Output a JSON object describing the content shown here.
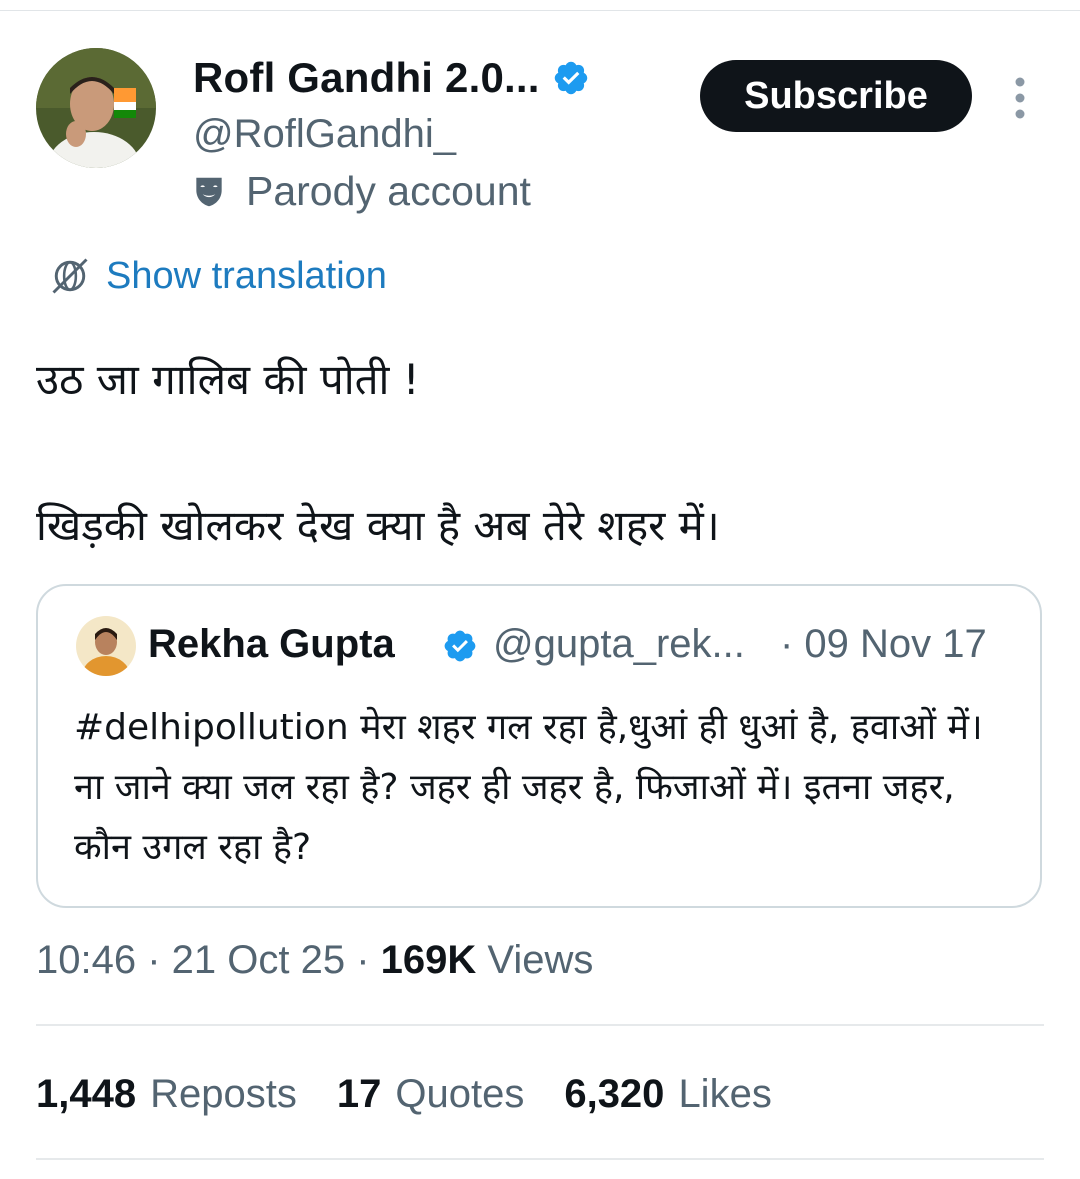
{
  "author": {
    "name": "Rofl Gandhi 2.0...",
    "handle": "@RoflGandhi_",
    "label": "Parody account",
    "verified": true
  },
  "actions": {
    "subscribe_label": "Subscribe"
  },
  "translation": {
    "label": "Show translation"
  },
  "tweet": {
    "line1": "उठ जा गालिब की पोती !",
    "line2": "खिड़की खोलकर देख क्या है अब तेरे शहर में।"
  },
  "quote": {
    "name": "Rekha Gupta",
    "handle": "@gupta_rek...",
    "date": "· 09 Nov 17",
    "text": "#delhipollution मेरा शहर गल रहा है,धुआं ही धुआं है, हवाओं में। ना जाने क्या जल रहा है? जहर ही जहर है, फिजाओं में। इतना जहर, कौन उगल रहा है?"
  },
  "meta": {
    "time_date": "10:46 · 21 Oct 25 · ",
    "views_count": "169K",
    "views_label": " Views"
  },
  "stats": {
    "reposts_count": "1,448",
    "reposts_label": "Reposts",
    "quotes_count": "17",
    "quotes_label": "Quotes",
    "likes_count": "6,320",
    "likes_label": "Likes"
  },
  "colors": {
    "accent": "#1d9bf0",
    "link": "#1d7bbf",
    "text": "#0f1419",
    "muted": "#536471",
    "border": "#cfd9de"
  }
}
